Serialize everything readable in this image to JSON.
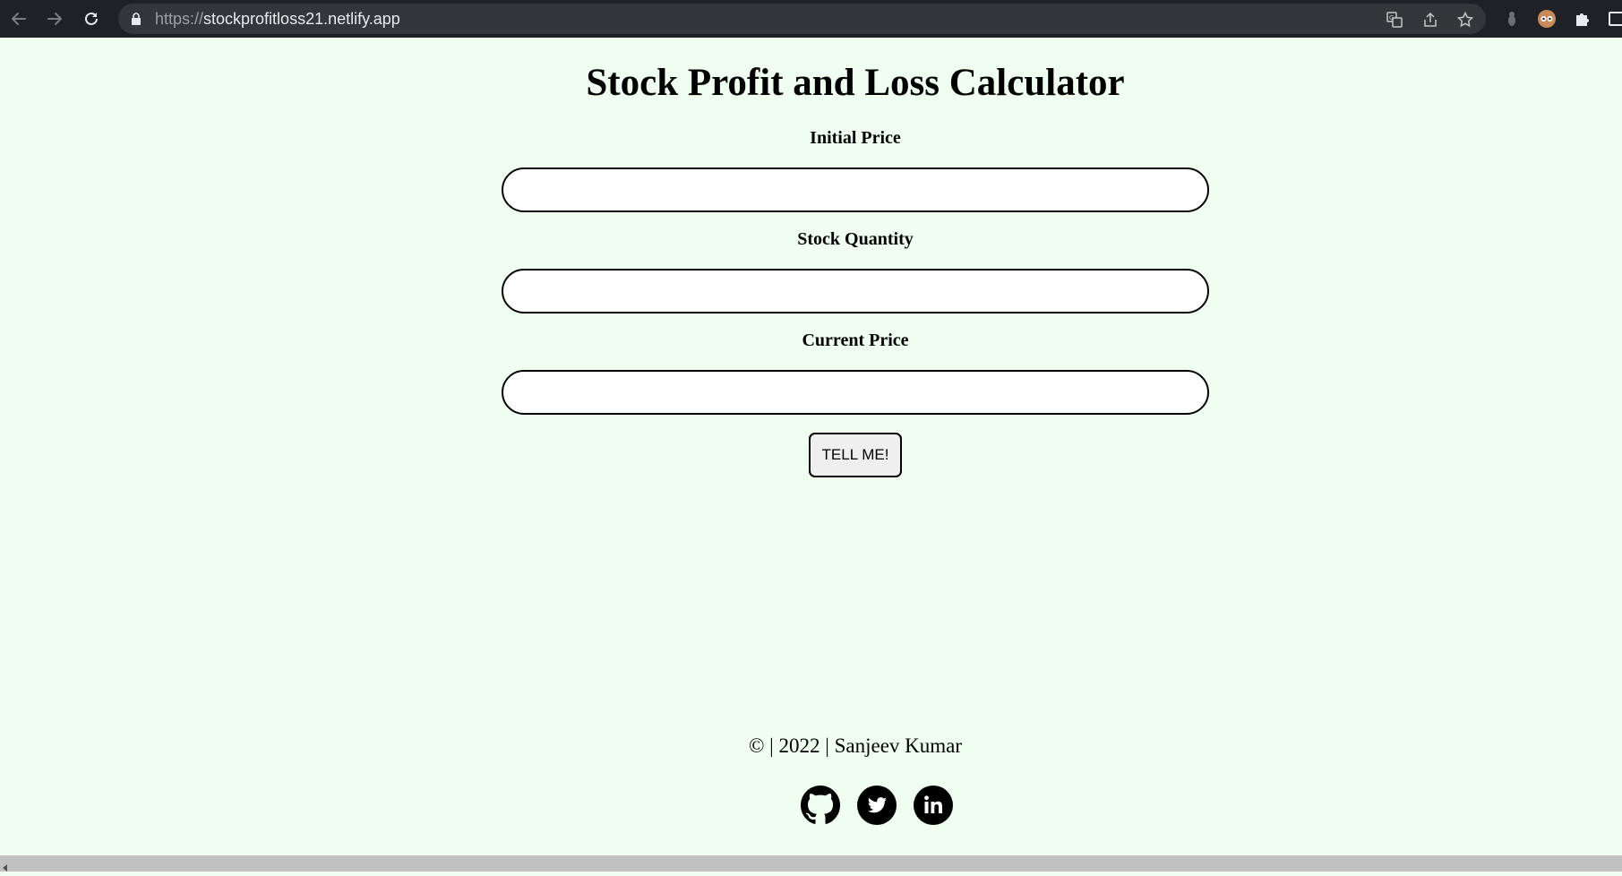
{
  "browser": {
    "url_scheme": "https://",
    "url_host": "stockprofitloss21.netlify.app",
    "icons": {
      "back": "back-arrow-icon",
      "forward": "forward-arrow-icon",
      "reload": "reload-icon",
      "lock": "lock-icon",
      "translate": "translate-icon",
      "share": "share-icon",
      "bookmark": "star-icon",
      "extension": "extension-icon",
      "profile": "profile-avatar-icon",
      "puzzle": "puzzle-icon",
      "side_panel": "side-panel-icon"
    }
  },
  "page": {
    "title": "Stock Profit and Loss Calculator",
    "background_color": "#effff0",
    "fields": [
      {
        "label": "Initial Price",
        "value": ""
      },
      {
        "label": "Stock Quantity",
        "value": ""
      },
      {
        "label": "Current Price",
        "value": ""
      }
    ],
    "submit_label": "TELL ME!",
    "footer": {
      "text": "© | 2022 | Sanjeev Kumar",
      "social": [
        "github-icon",
        "twitter-icon",
        "linkedin-icon"
      ]
    }
  }
}
